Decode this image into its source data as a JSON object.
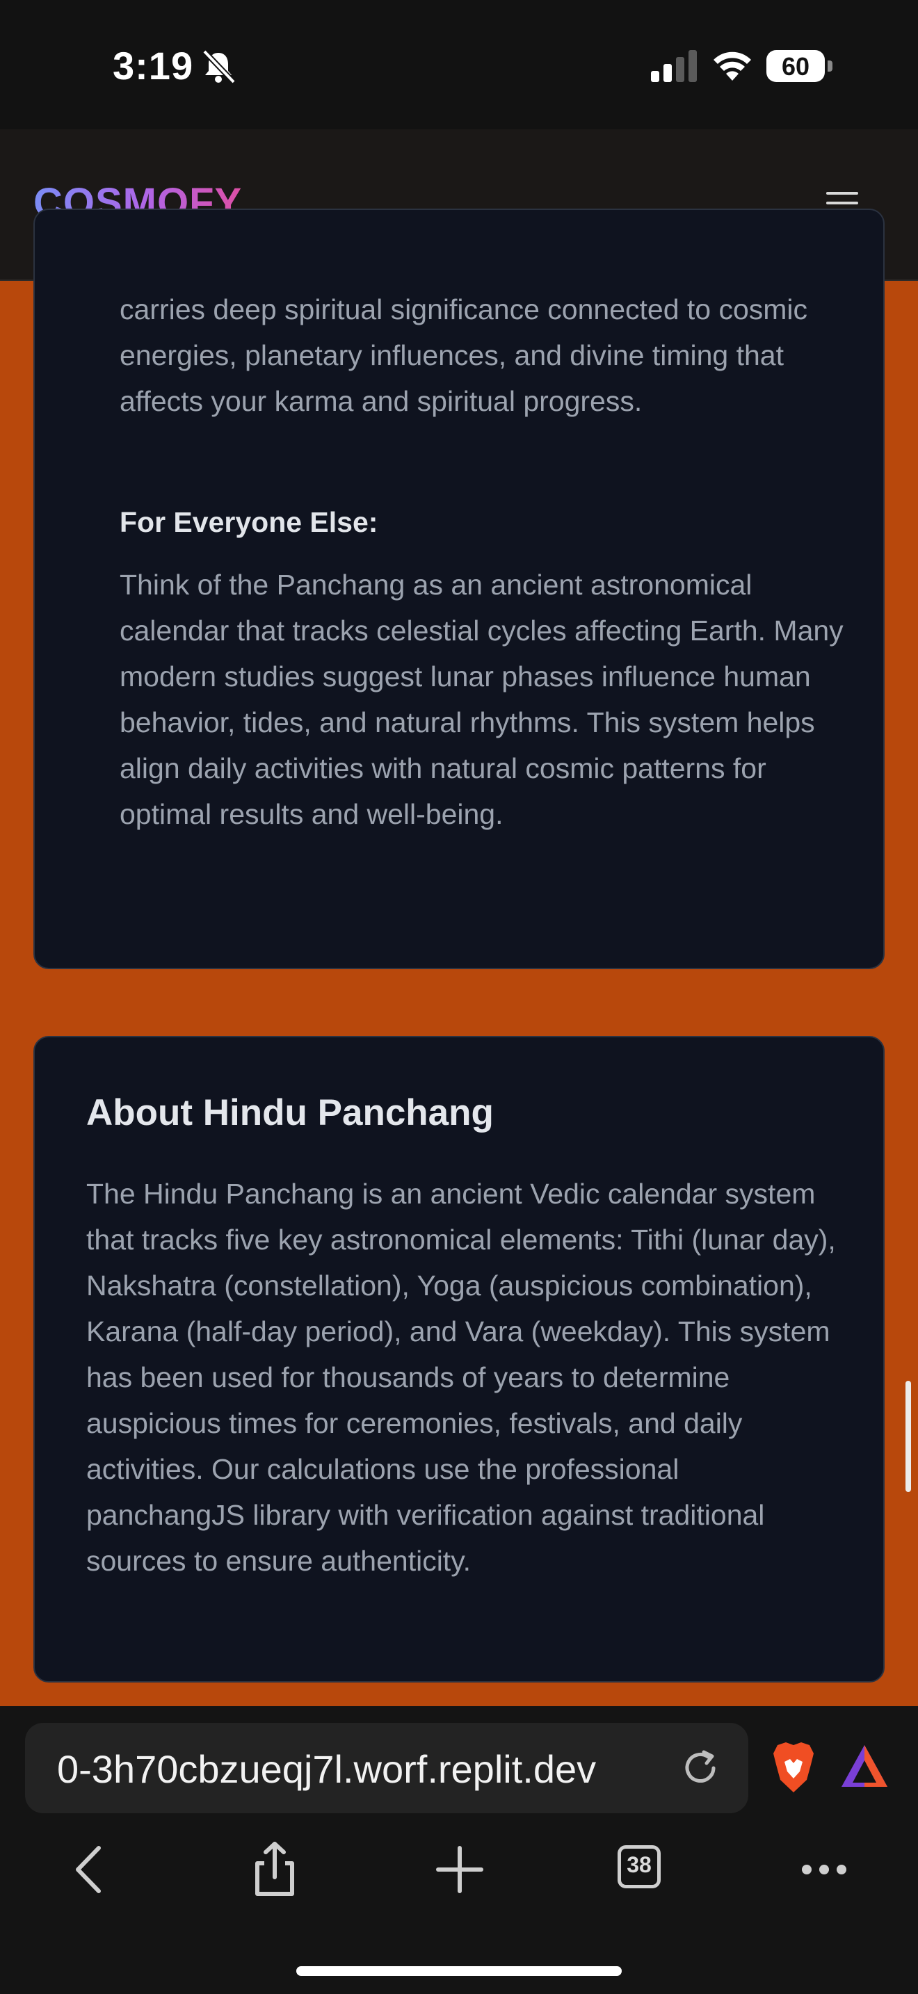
{
  "status_bar": {
    "time": "3:19",
    "battery_percent": "60"
  },
  "header": {
    "logo": "COSMOFY"
  },
  "spiritual_card": {
    "intro_text": "carries deep spiritual significance connected to cosmic energies, planetary influences, and divine timing that affects your karma and spiritual progress.",
    "everyone_heading": "For Everyone Else:",
    "everyone_text": "Think of the Panchang as an ancient astronomical calendar that tracks celestial cycles affecting Earth. Many modern studies suggest lunar phases influence human behavior, tides, and natural rhythms. This system helps align daily activities with natural cosmic patterns for optimal results and well-being."
  },
  "about_card": {
    "title": "About Hindu Panchang",
    "text": "The Hindu Panchang is an ancient Vedic calendar system that tracks five key astronomical elements: Tithi (lunar day), Nakshatra (constellation), Yoga (auspicious combination), Karana (half-day period), and Vara (weekday). This system has been used for thousands of years to determine auspicious times for ceremonies, festivals, and daily activities. Our calculations use the professional panchangJS library with verification against traditional sources to ensure authenticity."
  },
  "browser": {
    "url": "0-3h70cbzueqj7l.worf.replit.dev",
    "tab_count": "38"
  },
  "colors": {
    "page_bg": "#b8480c",
    "card_bg": "#0f131f",
    "header_bg": "#1b1817"
  },
  "icons": [
    "bell-slash-icon",
    "signal-icon",
    "wifi-icon",
    "battery-icon",
    "hamburger-menu-icon",
    "reload-icon",
    "brave-lion-icon",
    "triangle-rewards-icon",
    "back-icon",
    "share-icon",
    "add-tab-icon",
    "tabs-icon",
    "more-icon"
  ]
}
